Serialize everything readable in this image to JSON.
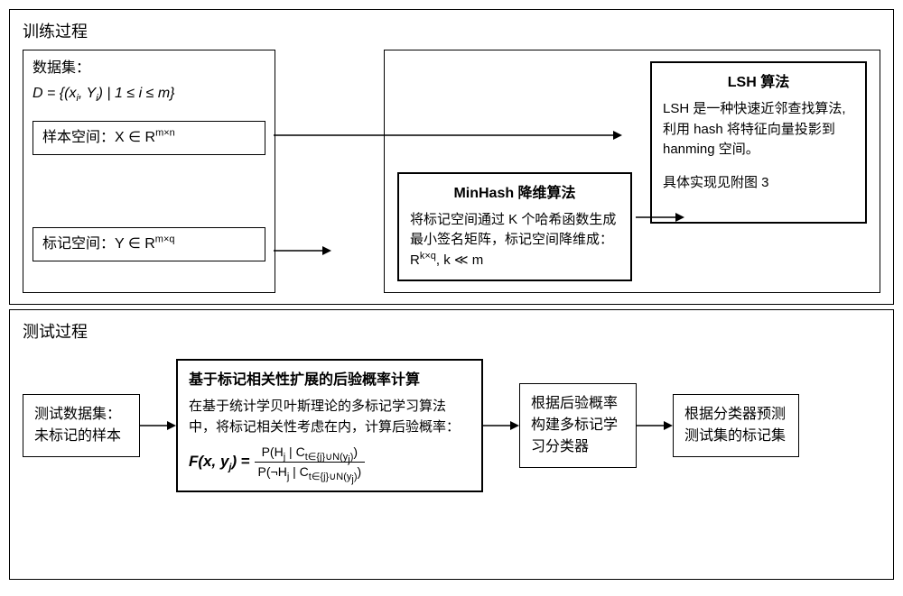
{
  "training": {
    "title": "训练过程",
    "dataset": {
      "label": "数据集：",
      "formula": "D = {(xᵢ, Yᵢ) | 1 ≤ i ≤ m}",
      "sample_space": "样本空间：X ∈ Rᵐˣⁿ",
      "label_space": "标记空间：Y ∈ Rᵐˣᵠ"
    },
    "minhash": {
      "title": "MinHash 降维算法",
      "body_line1": "将标记空间通过 K 个哈希函数生成最小签名矩阵，标记空间降维成：",
      "body_line2": "Rᵏˣᵠ, k ≪ m"
    },
    "lsh": {
      "title": "LSH 算法",
      "body_line1": "LSH 是一种快速近邻查找算法,利用 hash 将特征向量投影到 hanming 空间。",
      "body_line2": "具体实现见附图 3"
    }
  },
  "testing": {
    "title": "测试过程",
    "dataset": {
      "line1": "测试数据集：",
      "line2": "未标记的样本"
    },
    "posterior": {
      "title": "基于标记相关性扩展的后验概率计算",
      "body": "在基于统计学贝叶斯理论的多标记学习算法中，将标记相关性考虑在内，计算后验概率：",
      "formula_left": "F(x, yⱼ) = ",
      "formula_num": "P(Hⱼ | C_{t∈{j}∪N(yⱼ)})",
      "formula_den": "P(¬Hⱼ | C_{t∈{j}∪N(yⱼ)})"
    },
    "classifier": "根据后验概率构建多标记学习分类器",
    "predict": "根据分类器预测测试集的标记集"
  }
}
